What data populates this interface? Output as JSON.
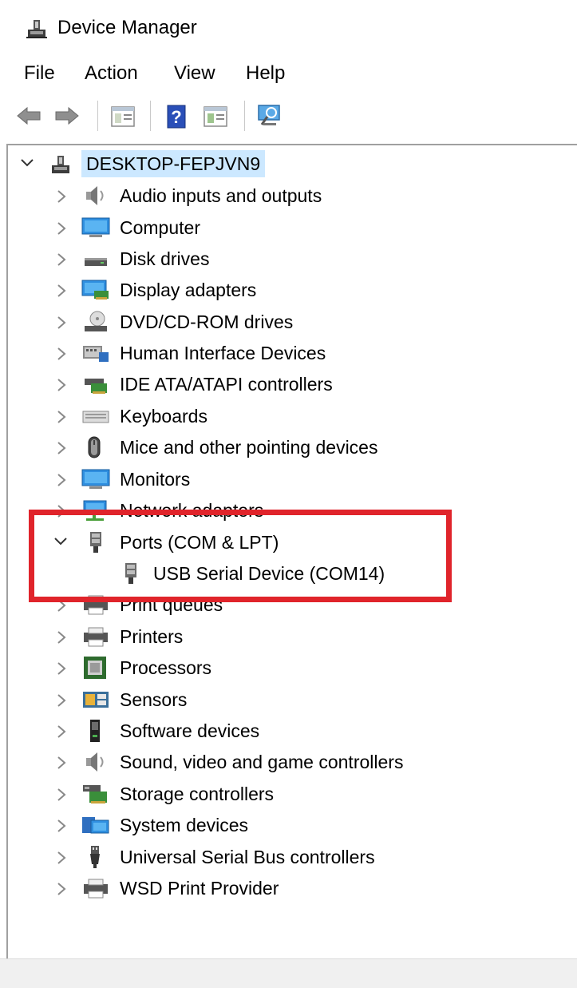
{
  "window": {
    "title": "Device Manager",
    "icon": "device-manager-icon"
  },
  "menu": {
    "items": [
      "File",
      "Action",
      "View",
      "Help"
    ]
  },
  "toolbar": {
    "buttons": [
      "back-arrow-icon",
      "forward-arrow-icon",
      "properties-icon",
      "help-icon",
      "update-driver-icon",
      "scan-hardware-icon"
    ]
  },
  "tree": {
    "root": {
      "label": "DESKTOP-FEPJVN9",
      "expanded": true,
      "icon": "computer-tree-icon"
    },
    "categories": [
      {
        "label": "Audio inputs and outputs",
        "icon": "speaker-icon",
        "expanded": false
      },
      {
        "label": "Computer",
        "icon": "monitor-icon",
        "expanded": false
      },
      {
        "label": "Disk drives",
        "icon": "disk-drive-icon",
        "expanded": false
      },
      {
        "label": "Display adapters",
        "icon": "display-adapter-icon",
        "expanded": false
      },
      {
        "label": "DVD/CD-ROM drives",
        "icon": "dvd-drive-icon",
        "expanded": false
      },
      {
        "label": "Human Interface Devices",
        "icon": "hid-icon",
        "expanded": false
      },
      {
        "label": "IDE ATA/ATAPI controllers",
        "icon": "ide-controller-icon",
        "expanded": false
      },
      {
        "label": "Keyboards",
        "icon": "keyboard-icon",
        "expanded": false
      },
      {
        "label": "Mice and other pointing devices",
        "icon": "mouse-icon",
        "expanded": false
      },
      {
        "label": "Monitors",
        "icon": "monitor-icon",
        "expanded": false
      },
      {
        "label": "Network adapters",
        "icon": "network-adapter-icon",
        "expanded": false
      },
      {
        "label": "Ports (COM & LPT)",
        "icon": "port-icon",
        "expanded": true,
        "children": [
          {
            "label": "USB Serial Device (COM14)",
            "icon": "port-icon"
          }
        ]
      },
      {
        "label": "Print queues",
        "icon": "printer-icon",
        "expanded": false
      },
      {
        "label": "Printers",
        "icon": "printer-icon",
        "expanded": false
      },
      {
        "label": "Processors",
        "icon": "processor-icon",
        "expanded": false
      },
      {
        "label": "Sensors",
        "icon": "sensor-icon",
        "expanded": false
      },
      {
        "label": "Software devices",
        "icon": "software-device-icon",
        "expanded": false
      },
      {
        "label": "Sound, video and game controllers",
        "icon": "speaker-icon",
        "expanded": false
      },
      {
        "label": "Storage controllers",
        "icon": "storage-controller-icon",
        "expanded": false
      },
      {
        "label": "System devices",
        "icon": "system-device-icon",
        "expanded": false
      },
      {
        "label": "Universal Serial Bus controllers",
        "icon": "usb-icon",
        "expanded": false
      },
      {
        "label": "WSD Print Provider",
        "icon": "printer-icon",
        "expanded": false
      }
    ]
  },
  "colors": {
    "selection": "#cce8ff",
    "highlight_annotation": "#e0242b"
  }
}
